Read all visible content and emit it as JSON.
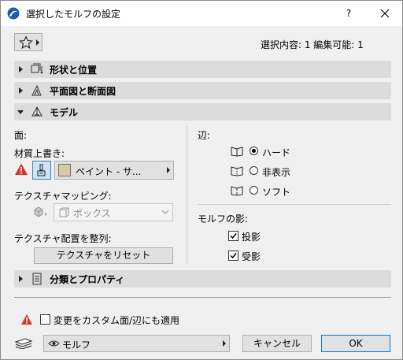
{
  "window": {
    "title": "選択したモルフの設定",
    "help_label": "?"
  },
  "header": {
    "summary": "選択内容: 1 編集可能: 1"
  },
  "sections": {
    "shape": "形状と位置",
    "plan": "平面図と断面図",
    "model": "モデル",
    "classification": "分類とプロパティ"
  },
  "faces": {
    "heading": "面:",
    "override_label": "材質上書き:",
    "material_value": "ペイント - サ...",
    "mapping_label": "テクスチャマッピング:",
    "mapping_value": "ボックス",
    "align_label": "テクスチャ配置を整列:",
    "reset_label": "テクスチャをリセット"
  },
  "edges": {
    "heading": "辺:",
    "options": [
      {
        "label": "ハード",
        "selected": true
      },
      {
        "label": "非表示",
        "selected": false
      },
      {
        "label": "ソフト",
        "selected": false
      }
    ]
  },
  "shadows": {
    "heading": "モルフの影:",
    "cast": {
      "label": "投影",
      "checked": true
    },
    "receive": {
      "label": "受影",
      "checked": true
    }
  },
  "footer": {
    "apply_custom_label": "変更をカスタム面/辺にも適用",
    "apply_custom_checked": false,
    "layer_value": "モルフ",
    "cancel_label": "キャンセル",
    "ok_label": "OK"
  },
  "colors": {
    "accent": "#0078d7",
    "warning": "#d9342b",
    "section_bg": "#dcdcdc",
    "swatch": "#d8c9a8"
  },
  "icons": [
    "app-icon",
    "close-icon",
    "star-icon",
    "shape-icon",
    "plan-icon",
    "model-icon",
    "warning-icon",
    "brush-icon",
    "cube-icon",
    "box-icon",
    "edge-hard-icon",
    "edge-hidden-icon",
    "edge-soft-icon",
    "document-icon",
    "layer-icon",
    "eye-icon"
  ]
}
